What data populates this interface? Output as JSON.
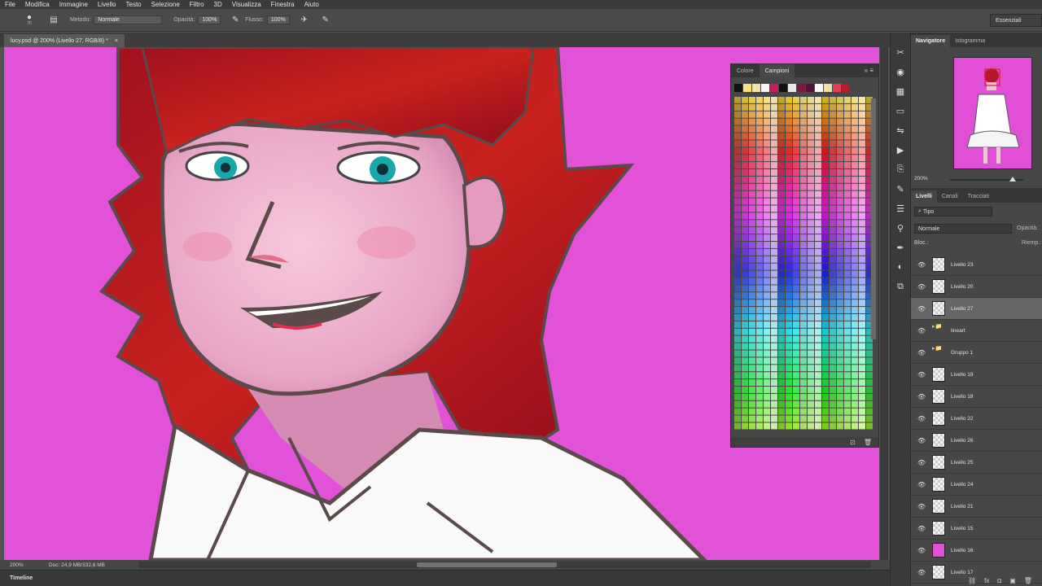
{
  "menu": [
    "File",
    "Modifica",
    "Immagine",
    "Livello",
    "Testo",
    "Selezione",
    "Filtro",
    "3D",
    "Visualizza",
    "Finestra",
    "Aiuto"
  ],
  "options": {
    "brush_size": "70",
    "mode_label": "Metodo:",
    "mode_value": "Normale",
    "opacity_label": "Opacità:",
    "opacity_value": "100%",
    "flow_label": "Flusso:",
    "flow_value": "100%",
    "workspace": "Essenziali"
  },
  "document_tab": {
    "title": "lucy.psd @ 200% (Livello 27, RGB/8) *",
    "close": "×"
  },
  "status": {
    "zoom": "200%",
    "doc": "Doc: 24,9 MB/332,6 MB"
  },
  "timeline": "Timeline",
  "swatches": {
    "tabs": [
      "Colore",
      "Campioni"
    ],
    "active_tab": "Campioni",
    "recent": [
      "#111111",
      "#f3e27d",
      "#f0e6a8",
      "#f4f4f4",
      "#c71d5e",
      "#111111",
      "#e9e9e9",
      "#7a1a3f",
      "#5a0f3a",
      "#f7f7f7",
      "#efe2a8",
      "#e43e5a",
      "#b71c2b"
    ]
  },
  "navigator": {
    "tabs": [
      "Navigatore",
      "Istogramma"
    ],
    "zoom": "200%"
  },
  "layers": {
    "tabs": [
      "Livelli",
      "Canali",
      "Tracciati"
    ],
    "filter": "Tipo",
    "blend": "Normale",
    "opacity_label": "Opacità:",
    "lock_label": "Bloc.:",
    "fill_label": "Riemp.:",
    "items": [
      {
        "name": "Livello 23"
      },
      {
        "name": "Livello 20"
      },
      {
        "name": "Livello 27"
      },
      {
        "name": "lineart"
      },
      {
        "name": "Gruppo 1"
      },
      {
        "name": "Livello 19"
      },
      {
        "name": "Livello 18"
      },
      {
        "name": "Livello 22"
      },
      {
        "name": "Livello 26"
      },
      {
        "name": "Livello 25"
      },
      {
        "name": "Livello 24"
      },
      {
        "name": "Livello 21"
      },
      {
        "name": "Livello 15"
      },
      {
        "name": "Livello 16"
      },
      {
        "name": "Livello 17"
      }
    ]
  }
}
